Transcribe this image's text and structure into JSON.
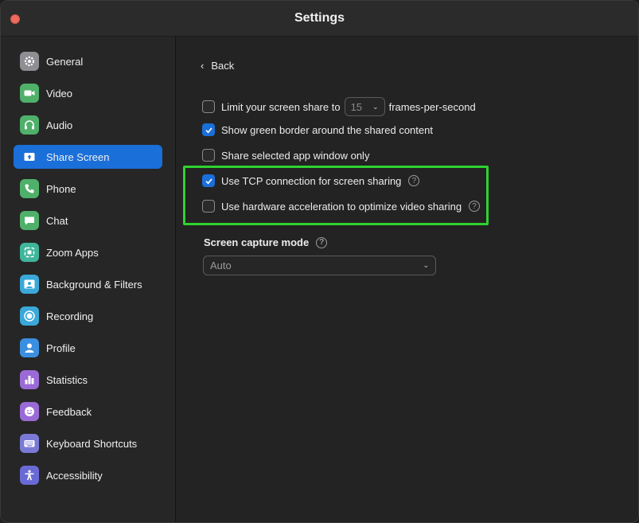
{
  "window": {
    "title": "Settings"
  },
  "sidebar": {
    "items": [
      {
        "label": "General",
        "icon": "gear-icon",
        "color": "#8e8e93",
        "active": false
      },
      {
        "label": "Video",
        "icon": "video-camera-icon",
        "color": "#4fb06a",
        "active": false
      },
      {
        "label": "Audio",
        "icon": "headphones-icon",
        "color": "#4fb06a",
        "active": false
      },
      {
        "label": "Share Screen",
        "icon": "share-screen-icon",
        "color": "#1a6fd9",
        "active": true
      },
      {
        "label": "Phone",
        "icon": "phone-icon",
        "color": "#4fb06a",
        "active": false
      },
      {
        "label": "Chat",
        "icon": "chat-bubble-icon",
        "color": "#4fb06a",
        "active": false
      },
      {
        "label": "Zoom Apps",
        "icon": "apps-icon",
        "color": "#3fb59a",
        "active": false
      },
      {
        "label": "Background & Filters",
        "icon": "background-icon",
        "color": "#3aa8d8",
        "active": false
      },
      {
        "label": "Recording",
        "icon": "record-icon",
        "color": "#3aa8d8",
        "active": false
      },
      {
        "label": "Profile",
        "icon": "person-icon",
        "color": "#3a8fe0",
        "active": false
      },
      {
        "label": "Statistics",
        "icon": "bar-chart-icon",
        "color": "#9a6ad6",
        "active": false
      },
      {
        "label": "Feedback",
        "icon": "smiley-icon",
        "color": "#9a6ad6",
        "active": false
      },
      {
        "label": "Keyboard Shortcuts",
        "icon": "keyboard-icon",
        "color": "#7a7ad6",
        "active": false
      },
      {
        "label": "Accessibility",
        "icon": "accessibility-icon",
        "color": "#6a6ad6",
        "active": false
      }
    ]
  },
  "content": {
    "back_label": "Back",
    "options": {
      "limit_prefix": "Limit your screen share to",
      "limit_fps_value": "15",
      "limit_suffix": "frames-per-second",
      "limit_checked": false,
      "green_border": "Show green border around the shared content",
      "green_border_checked": true,
      "selected_app": "Share selected app window only",
      "selected_app_checked": false,
      "tcp": "Use TCP connection for screen sharing",
      "tcp_checked": true,
      "hw_accel": "Use hardware acceleration to optimize video sharing",
      "hw_accel_checked": false
    },
    "capture_mode_title": "Screen capture mode",
    "capture_mode_value": "Auto",
    "help_glyph": "?"
  },
  "colors": {
    "accent": "#1a6fd9",
    "highlight": "#2fd22f"
  }
}
